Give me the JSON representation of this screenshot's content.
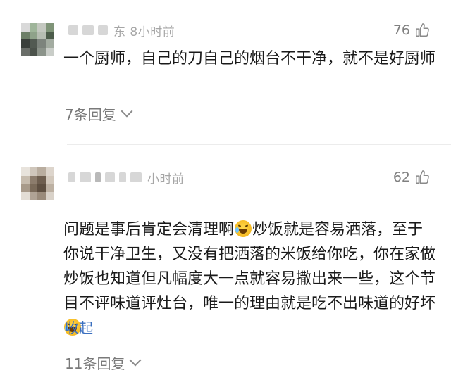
{
  "comments": [
    {
      "time": "东 8小时前",
      "likes": "76",
      "text": "一个厨师，自己的刀自己的烟台不干净，就不是好厨师",
      "replies_label": "7条回复",
      "avatar_colors": [
        "#d9d9d9",
        "#9fb59a",
        "#c4c8c0",
        "#7f9478",
        "#6d7f68",
        "#8fa28a",
        "#b6bdb2",
        "#4c5c4a",
        "#3a3f3b",
        "#525a52",
        "#7d847d",
        "#a3aca1",
        "#6a6e69",
        "#4b524b",
        "#8b938a",
        "#c9cdc8"
      ]
    },
    {
      "time": "小时前",
      "likes": "62",
      "text_parts": [
        "问题是事后肯定会清理啊",
        "炒饭就是容易洒落，至于你说干净卫生，又没有把洒落的米饭给你吃，你在家做炒饭也知道但凡幅度大一点就容易撒出来一些，这个节目不评味道评灶台，唯一的理由就是吃不出味道的好坏"
      ],
      "collapse_label": "收起",
      "replies_label": "11条回复",
      "avatar_colors": [
        "#e8e3dc",
        "#cfc6bb",
        "#b9ad9f",
        "#ddd5cc",
        "#c7bcae",
        "#8c7c6c",
        "#6e5e4f",
        "#d2c8bc",
        "#a89a8a",
        "#7a6a59",
        "#5e4f41",
        "#bdb1a3",
        "#e3ddd5",
        "#b0a395",
        "#9a8b7b",
        "#d9d2c9"
      ]
    }
  ]
}
